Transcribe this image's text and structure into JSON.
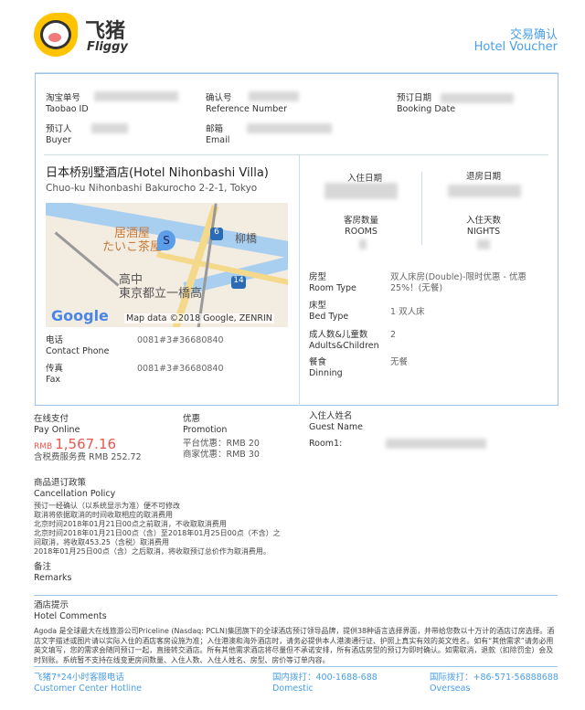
{
  "header": {
    "logo_cn": "飞猪",
    "logo_en": "Fliggy",
    "title_cn": "交易确认",
    "title_en": "Hotel Voucher"
  },
  "order": {
    "taobao_cn": "淘宝单号",
    "taobao_en": "Taobao ID",
    "ref_cn": "确认号",
    "ref_en": "Reference Number",
    "date_cn": "预订日期",
    "date_en": "Booking Date",
    "buyer_cn": "预订人",
    "buyer_en": "Buyer",
    "email_cn": "邮箱",
    "email_en": "Email"
  },
  "hotel": {
    "name": "日本桥别墅酒店(Hotel Nihonbashi Villa)",
    "address": "Chuo-ku Nihonbashi Bakurocho 2-2-1, Tokyo",
    "map": {
      "label1": "居酒屋",
      "label2": "たいこ茶屋",
      "label3": "柳橋",
      "label4": "高中",
      "label5": "東京都立一橋高",
      "route1": "6",
      "route2": "14",
      "pin": "S",
      "google": "Google",
      "attribution": "Map data ©2018 Google, ZENRIN"
    },
    "phone_cn": "电话",
    "phone_en": "Contact Phone",
    "phone": "0081#3#36680840",
    "fax_cn": "传真",
    "fax_en": "Fax",
    "fax": "0081#3#36680840"
  },
  "stay": {
    "checkin_cn": "入住日期",
    "checkout_cn": "退房日期",
    "rooms_cn": "客房数量",
    "rooms_en": "ROOMS",
    "nights_cn": "入住天数",
    "nights_en": "NIGHTS",
    "room_type_cn": "房型",
    "room_type_en": "Room Type",
    "room_type": "双人床房(Double)-限时优惠 - 优惠25%！(无餐)",
    "bed_cn": "床型",
    "bed_en": "Bed Type",
    "bed": "1 双人床",
    "adults_cn": "成人数&儿童数",
    "adults_en": "Adults&Children",
    "adults": "2",
    "meal_cn": "餐食",
    "meal_en": "Dinning",
    "meal": "无餐"
  },
  "payment": {
    "cn": "在线支付",
    "en": "Pay Online",
    "currency": "RMB",
    "amount": "1,567.16",
    "tax": "含税费服务费 RMB 252.72",
    "promo_cn": "优惠",
    "promo_en": "Promotion",
    "promo1": "平台优惠：RMB 20",
    "promo2": "商家优惠：RMB 30",
    "guest_cn": "入住人姓名",
    "guest_en": "Guest Name",
    "room1": "Room1:"
  },
  "policy": {
    "cn": "商品退订政策",
    "en": "Cancellation Policy",
    "lines": [
      "预订一经确认（以系统显示为准）便不可修改",
      "取消将依据取消的时间收取相应的取消费用",
      "北京时间2018年01月21日00点之前取消，不收取取消费用",
      "北京时间2018年01月21日00点（含）至2018年01月25日00点（不含）之",
      "间取消，将收取453.25（含税）取消费用",
      "2018年01月25日00点（含）之后取消，将收取预订总价作为取消费用。"
    ]
  },
  "remarks": {
    "cn": "备注",
    "en": "Remarks"
  },
  "comments": {
    "cn": "酒店提示",
    "en": "Hotel Comments",
    "text": "Agoda 是全球最大在线旅游公司Priceline (Nasdaq: PCLN)集团旗下的全球酒店预订领导品牌，提供38种语言选择界面，并带给您数以十万计的酒店订房选择。酒店文字描述或图片请以实际入住的酒店客房设施为准；入住港澳和海外酒店时，请务必提供本人港澳通行证、护照上真实有效的英文姓名。如有“其他需求”请务必用英文填写，您的需求会随同预订一起，直接转交酒店。所有其他需求酒店将尽量但不承诺安排，所有酒店房型的预订为即时确认。如需取消，退款（扣除罚金）会及时到账。系统暂不支持在线变更房间数量、入住人数、入住人姓名、房型、房价等订单内容。"
  },
  "footer": {
    "hotline_cn": "飞猪7*24小时客服电话",
    "hotline_en": "Customer Center Hotline",
    "domestic_cn": "国内拨打：400-1688-688",
    "domestic_en": "Domestic",
    "overseas_cn": "国际拨打：+86-571-56888688",
    "overseas_en": "Overseas"
  }
}
